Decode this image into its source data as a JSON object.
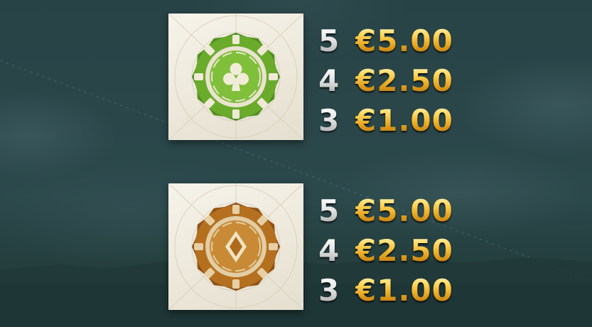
{
  "symbols": [
    {
      "name": "green club chip",
      "icon": "club-chip-icon",
      "color": "#6fae2e",
      "payouts": [
        {
          "count": "5",
          "value": "€5.00"
        },
        {
          "count": "4",
          "value": "€2.50"
        },
        {
          "count": "3",
          "value": "€1.00"
        }
      ]
    },
    {
      "name": "bronze diamond chip",
      "icon": "diamond-chip-icon",
      "color": "#b8741e",
      "payouts": [
        {
          "count": "5",
          "value": "€5.00"
        },
        {
          "count": "4",
          "value": "€2.50"
        },
        {
          "count": "3",
          "value": "€1.00"
        }
      ]
    }
  ],
  "colors": {
    "background": "#2a4649",
    "payout_gold": "#f2c23c",
    "count_silver": "#d9d9d9",
    "card": "#efebdf"
  }
}
